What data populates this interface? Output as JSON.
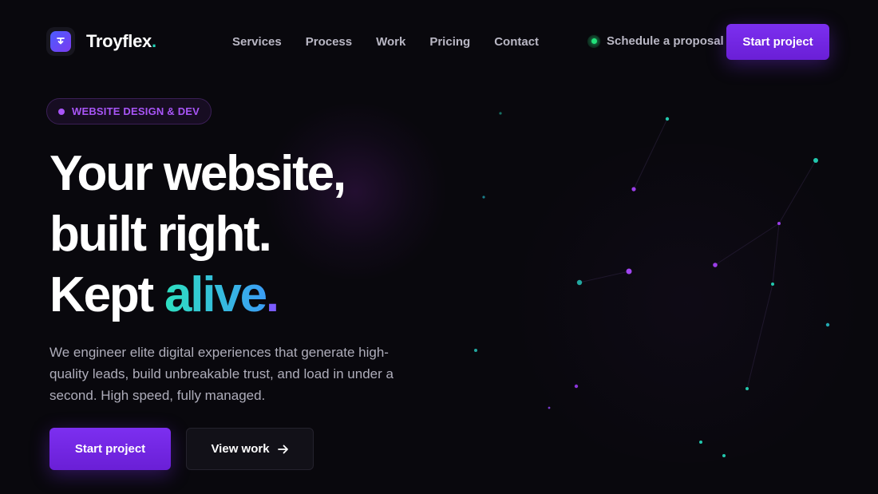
{
  "brand": {
    "name": "Troyflex",
    "dot": "."
  },
  "nav": {
    "items": [
      {
        "label": "Services"
      },
      {
        "label": "Process"
      },
      {
        "label": "Work"
      },
      {
        "label": "Pricing"
      },
      {
        "label": "Contact"
      }
    ],
    "schedule_label": "Schedule a proposal",
    "cta_label": "Start project"
  },
  "hero": {
    "badge": "WEBSITE DESIGN & DEV",
    "line1": "Your website,",
    "line2": "built right.",
    "line3_prefix": "Kept ",
    "line3_accent": "alive",
    "line3_dot": ".",
    "description": "We engineer elite digital experiences that generate high-quality leads, build unbreakable trust, and load in under a second. High speed, fully managed.",
    "primary_cta": "Start project",
    "secondary_cta": "View work"
  },
  "colors": {
    "background": "#09080d",
    "accent_purple": "#7c2ff0",
    "accent_teal": "#2ee0c0",
    "status_green": "#22e07a"
  }
}
